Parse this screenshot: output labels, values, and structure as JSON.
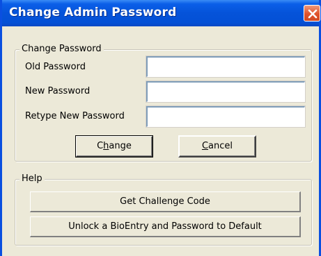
{
  "window": {
    "title": "Change Admin Password"
  },
  "change_password": {
    "legend": "Change Password",
    "old_label": "Old Password",
    "new_label": "New Password",
    "retype_label": "Retype New Password",
    "old_value": "",
    "new_value": "",
    "retype_value": "",
    "change_button": {
      "prefix": "C",
      "mnemonic": "h",
      "suffix": "ange"
    },
    "cancel_button": {
      "prefix": "",
      "mnemonic": "C",
      "suffix": "ancel"
    }
  },
  "help": {
    "legend": "Help",
    "challenge_button": "Get Challenge Code",
    "unlock_button": "Unlock a BioEntry and Password to Default"
  },
  "colors": {
    "titlebar": "#0553d9",
    "close": "#e0522b",
    "face": "#ece9d8"
  },
  "icons": {
    "close": "close-icon"
  }
}
